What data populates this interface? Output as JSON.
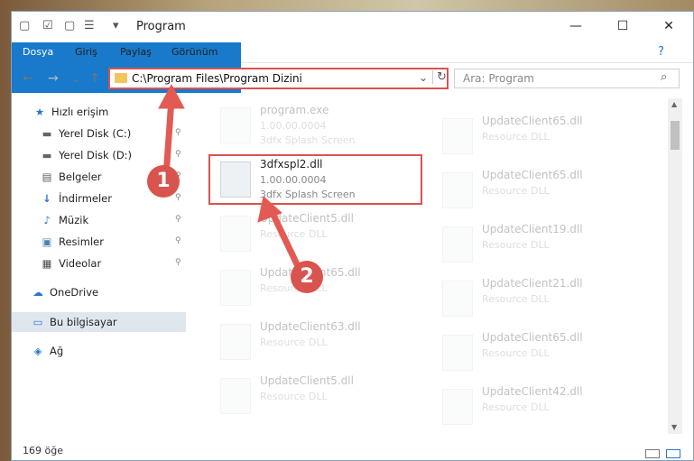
{
  "titlebar": {
    "title": "Program",
    "minimize": "—",
    "maximize": "☐",
    "close": "✕"
  },
  "ribbon": {
    "tabs": [
      "Dosya",
      "Giriş",
      "Paylaş",
      "Görünüm"
    ]
  },
  "nav": {
    "back": "←",
    "forward": "→",
    "recent": "⌄",
    "up": "↑",
    "address": "C:\\Program Files\\Program Dizini",
    "address_dropdown": "⌄",
    "refresh": "↻"
  },
  "search": {
    "placeholder": "Ara: Program",
    "icon": "⌕"
  },
  "sidebar": {
    "items": [
      {
        "label": "Hızlı erişim",
        "icon": "★"
      },
      {
        "label": "Yerel Disk (C:)",
        "icon": "▬"
      },
      {
        "label": "Yerel Disk (D:)",
        "icon": "▬"
      },
      {
        "label": "Belgeler",
        "icon": "▤"
      },
      {
        "label": "İndirmeler",
        "icon": "↓"
      },
      {
        "label": "Müzik",
        "icon": "♪"
      },
      {
        "label": "Resimler",
        "icon": "▣"
      },
      {
        "label": "Videolar",
        "icon": "▦"
      },
      {
        "label": "OneDrive",
        "icon": "☁"
      },
      {
        "label": "Bu bilgisayar",
        "icon": "▭"
      },
      {
        "label": "Ağ",
        "icon": "◈"
      }
    ]
  },
  "files": {
    "left": [
      {
        "name": "program.exe",
        "version": "1.00.00.0004",
        "desc": "3dfx Splash Screen"
      },
      {
        "name": "3dfxspl2.dll",
        "version": "1.00.00.0004",
        "desc": "3dfx Splash Screen"
      },
      {
        "name": "UpdateClient5.dll",
        "version": "Resource DLL",
        "desc": ""
      },
      {
        "name": "UpdateClient65.dll",
        "version": "Resource DLL",
        "desc": ""
      },
      {
        "name": "UpdateClient63.dll",
        "version": "Resource DLL",
        "desc": ""
      },
      {
        "name": "UpdateClient5.dll",
        "version": "Resource DLL",
        "desc": ""
      }
    ],
    "right": [
      {
        "name": "UpdateClient65.dll",
        "version": "Resource DLL"
      },
      {
        "name": "UpdateClient65.dll",
        "version": "Resource DLL"
      },
      {
        "name": "UpdateClient19.dll",
        "version": "Resource DLL"
      },
      {
        "name": "UpdateClient21.dll",
        "version": "Resource DLL"
      },
      {
        "name": "UpdateClient65.dll",
        "version": "Resource DLL"
      },
      {
        "name": "UpdateClient42.dll",
        "version": "Resource DLL"
      }
    ]
  },
  "status": {
    "count": "169 öğe"
  },
  "markers": {
    "one": "1",
    "two": "2"
  },
  "colors": {
    "accent": "#1979ca",
    "highlight": "#d9534f"
  }
}
